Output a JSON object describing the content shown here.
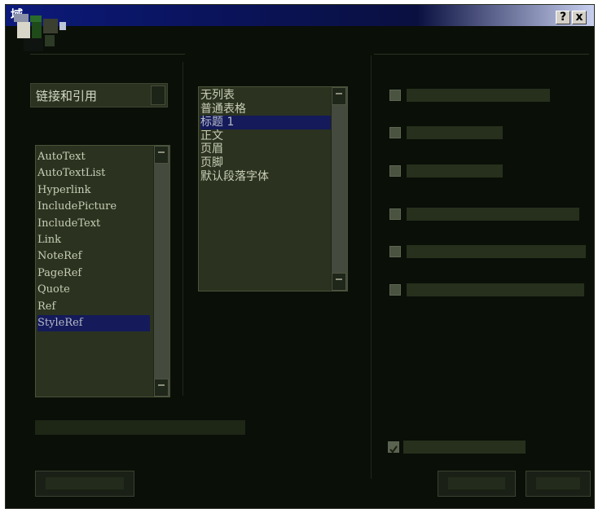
{
  "window": {
    "title": "域",
    "help_button": "?",
    "close_button": "x"
  },
  "combo": {
    "value": "链接和引用"
  },
  "field_names": [
    "AutoText",
    "AutoTextList",
    "Hyperlink",
    "IncludePicture",
    "IncludeText",
    "Link",
    "NoteRef",
    "PageRef",
    "Quote",
    "Ref",
    "StyleRef"
  ],
  "field_selected_index": 10,
  "style_names": [
    "无列表",
    "普通表格",
    "标题 1",
    "正文",
    "页眉",
    "页脚",
    "默认段落字体"
  ],
  "style_selected_index": 2,
  "options": {
    "checkboxes": [
      {
        "checked": false
      },
      {
        "checked": false
      },
      {
        "checked": false
      },
      {
        "checked": false
      },
      {
        "checked": false
      },
      {
        "checked": false
      }
    ],
    "preserve_format_checked": true
  },
  "icons": [
    "field-dialog-icon",
    "help-icon",
    "close-icon",
    "dropdown-arrow-icon",
    "scroll-up-icon",
    "scroll-down-icon",
    "checkmark-icon"
  ]
}
